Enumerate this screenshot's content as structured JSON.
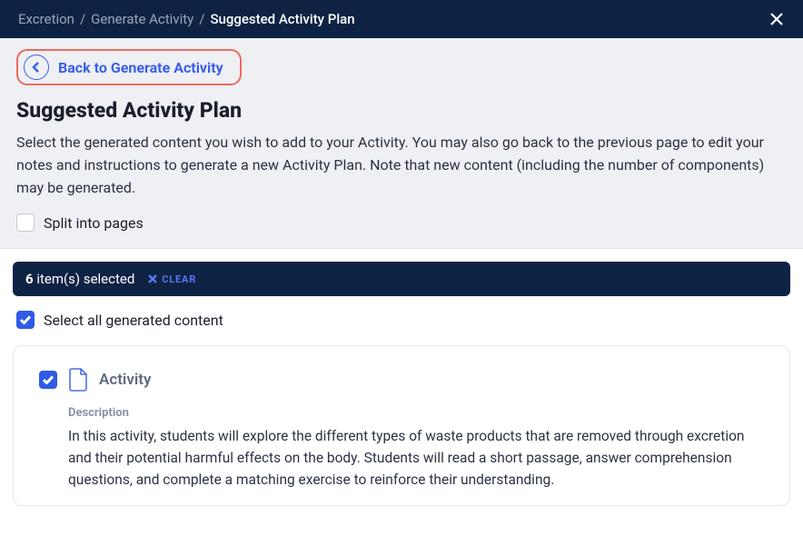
{
  "breadcrumb": {
    "level1": "Excretion",
    "level2": "Generate Activity",
    "level3": "Suggested Activity Plan"
  },
  "back_button": {
    "label": "Back to Generate Activity"
  },
  "page": {
    "title": "Suggested Activity Plan",
    "description": "Select the generated content you wish to add to your Activity. You may also go back to the previous page to edit your notes and instructions to generate a new Activity Plan. Note that new content (including the number of components) may be generated."
  },
  "split_option": {
    "label": "Split into pages",
    "checked": false
  },
  "selection_bar": {
    "count": "6",
    "text": "item(s) selected",
    "clear_label": "CLEAR"
  },
  "select_all": {
    "label": "Select all generated content",
    "checked": true
  },
  "activity_card": {
    "checked": true,
    "title": "Activity",
    "description_label": "Description",
    "description_body": "In this activity, students will explore the different types of waste products that are removed through excretion and their potential harmful effects on the body. Students will read a short passage, answer comprehension questions, and complete a matching exercise to reinforce their understanding."
  }
}
